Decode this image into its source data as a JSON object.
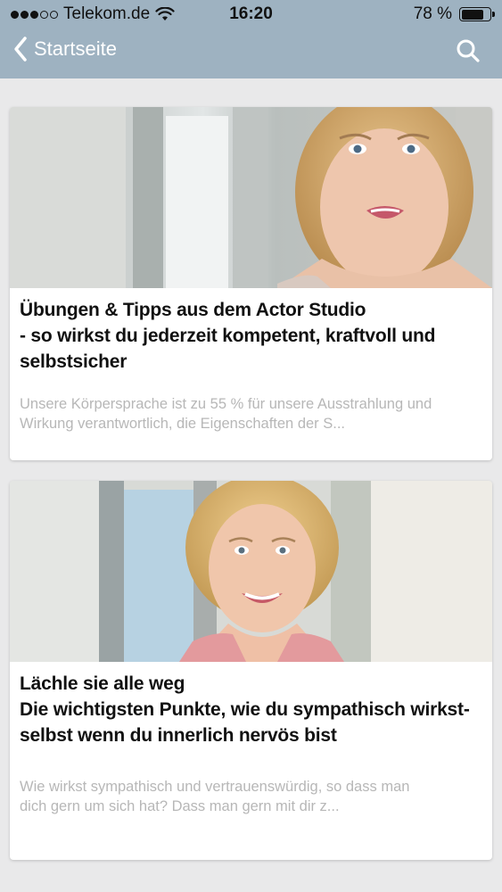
{
  "status_bar": {
    "carrier": "Telekom.de",
    "time": "16:20",
    "battery_percent": "78 %",
    "battery_level": 0.78,
    "signal_bars_filled": 3,
    "signal_bars_total": 5
  },
  "nav": {
    "back_label": "Startseite",
    "back_icon": "chevron-left-icon",
    "search_icon": "search-icon"
  },
  "colors": {
    "nav_background": "#9eb2c1",
    "page_background": "#e9e9ea",
    "title_text": "#111111",
    "excerpt_text": "#b7b7b7"
  },
  "articles": [
    {
      "title_lines": [
        "Übungen & Tipps aus dem Actor Studio",
        "- so wirkst du jederzeit kompetent, kraftvoll und",
        "selbstsicher"
      ],
      "excerpt_lines": [
        "Unsere Körpersprache ist zu 55 % für unsere Ausstrahlung und",
        "Wirkung verantwortlich, die Eigenschaften der S..."
      ]
    },
    {
      "title_lines": [
        "Lächle sie alle weg",
        "Die wichtigsten Punkte, wie du sympathisch wirkst-",
        "selbst wenn du innerlich nervös bist"
      ],
      "excerpt_lines": [
        "Wie wirkst sympathisch und vertrauenswürdig, so dass man",
        "dich gern um sich hat? Dass man gern mit dir z..."
      ]
    }
  ]
}
